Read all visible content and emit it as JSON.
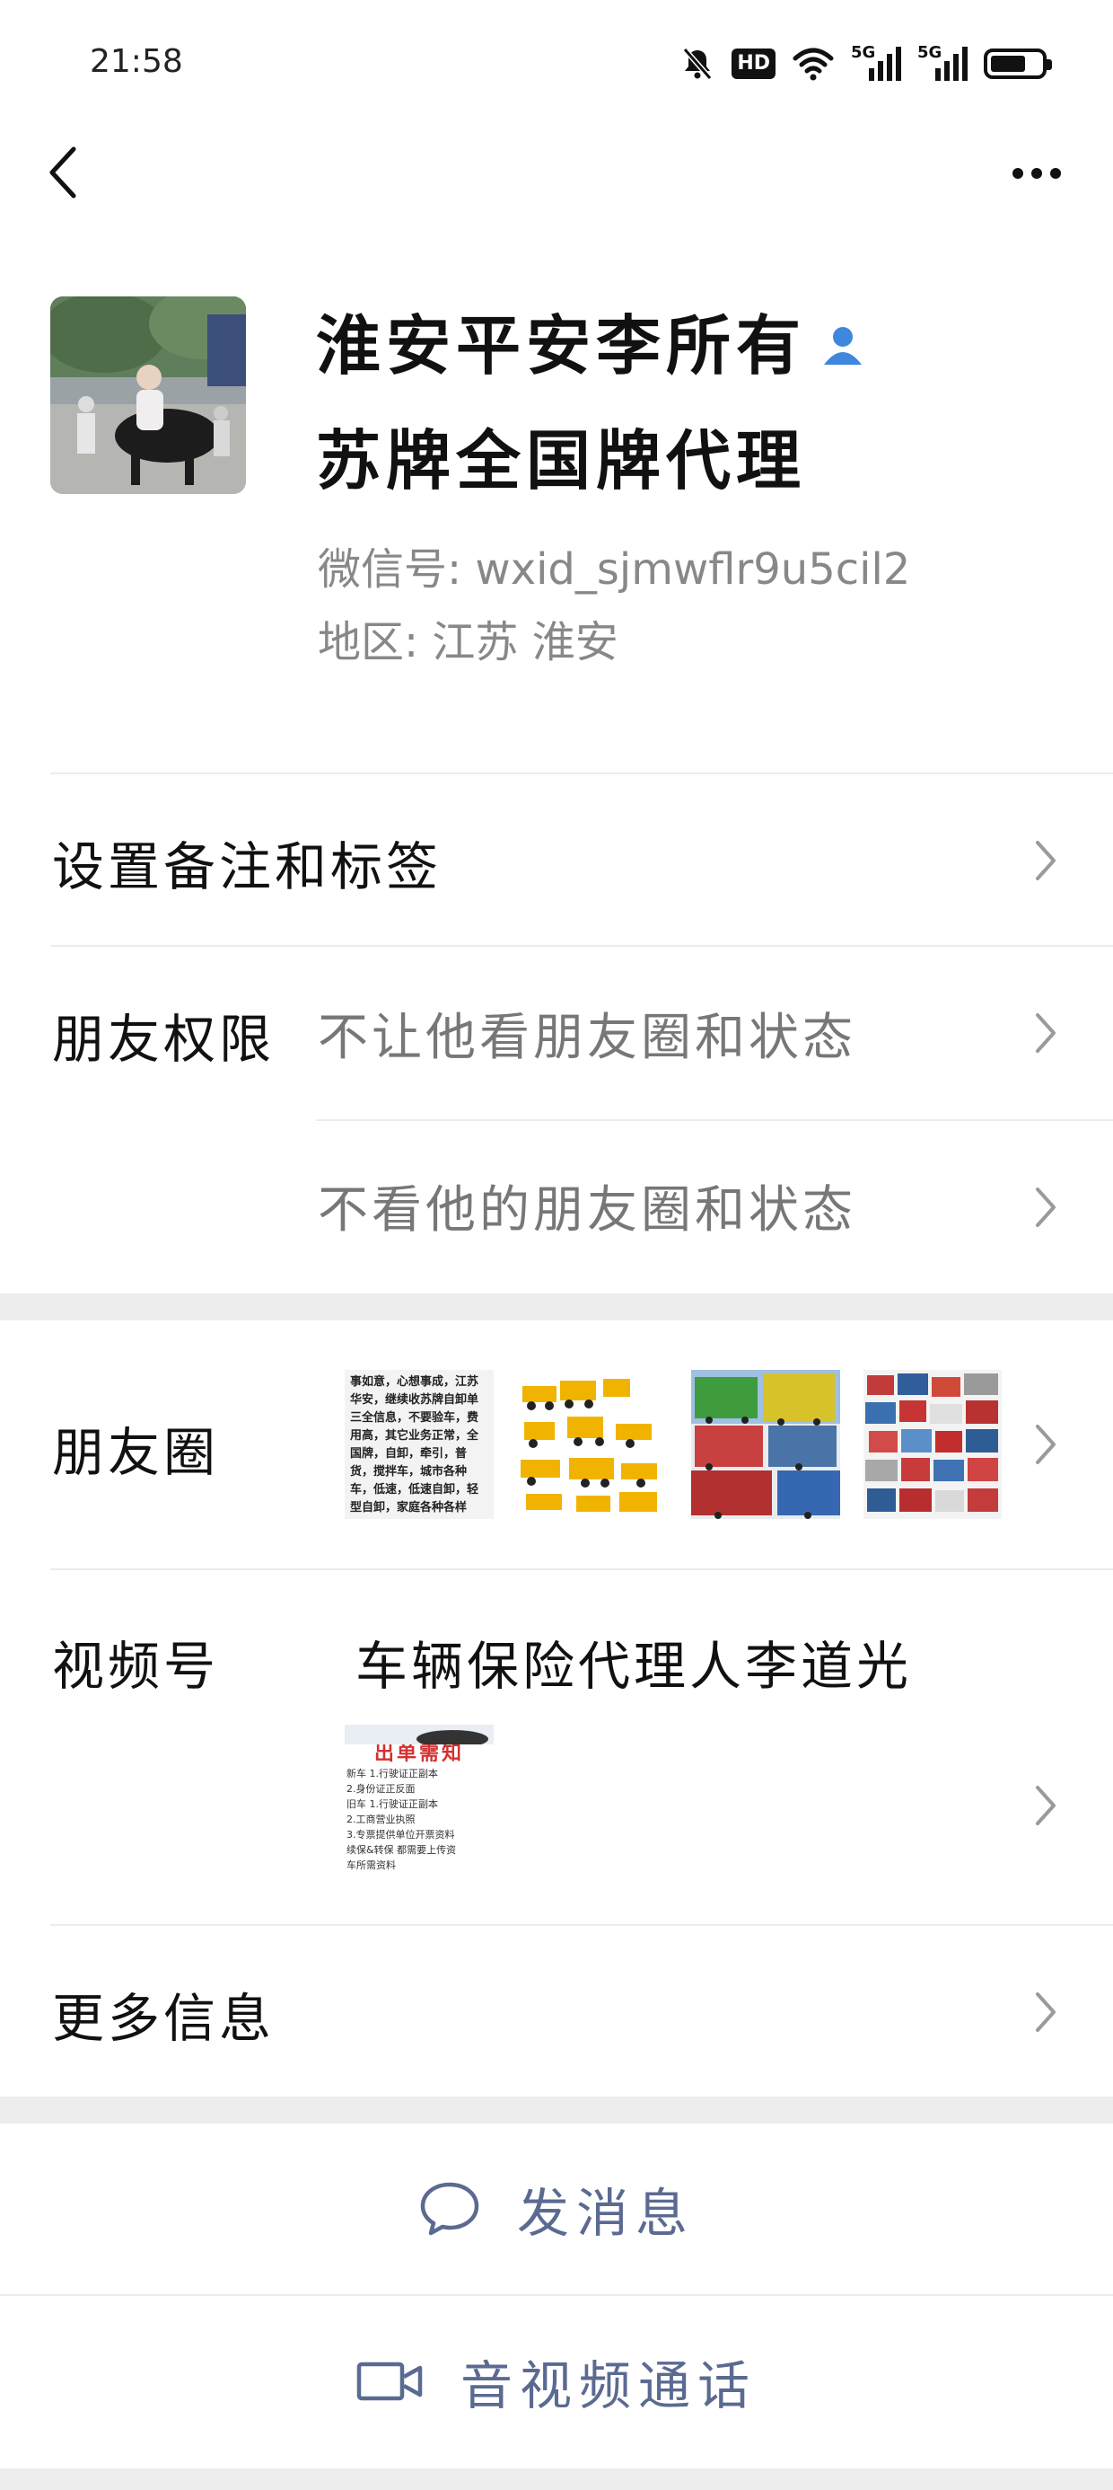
{
  "status_bar": {
    "time": "21:58",
    "hd_label": "HD",
    "signal_1": "5G",
    "signal_2": "5G",
    "battery_level": 0.7,
    "icons": [
      "bell-muted-icon",
      "hd-icon",
      "wifi-icon",
      "signal-5g-icon",
      "signal-5g-icon",
      "battery-icon"
    ]
  },
  "nav": {
    "back_icon": "chevron-left-icon",
    "more_icon": "more-dots-icon"
  },
  "profile": {
    "name_line_1": "淮安平安李所有",
    "name_line_2": "苏牌全国牌代理",
    "wechat_id": "微信号: wxid_sjmwflr9u5cil2",
    "region": "地区: 江苏 淮安"
  },
  "rows": {
    "remark": {
      "label": "设置备注和标签"
    },
    "permissions": {
      "label": "朋友权限",
      "value_1": "不让他看朋友圈和状态",
      "value_2": "不看他的朋友圈和状态"
    },
    "moments": {
      "label": "朋友圈",
      "thumb_1_text": "事如意，心想事成，江苏华安，继续收苏牌自卸单三全信息，不要验车，费用高，其它业务正常，全国牌，自卸，牵引，普货，搅拌车，城市各种车，低速，低速自卸，轻型自卸，家庭各种各样"
    },
    "channels": {
      "label": "视频号",
      "value": "车辆保险代理人李道光",
      "thumb_title": "出单需知",
      "thumb_lines": [
        "新车  1.行驶证正副本",
        "      2.身份证正反面",
        "旧车  1.行驶证正副本",
        "      2.工商营业执照",
        "      3.专票提供单位开票资料",
        "  续保&转保    都需要上传资",
        "车所需资料"
      ]
    },
    "more_info": {
      "label": "更多信息"
    }
  },
  "actions": {
    "message": "发消息",
    "call": "音视频通话"
  },
  "colors": {
    "accent_link": "#5b6a91",
    "verified_blue": "#3f86de",
    "divider": "#ececec",
    "section_gap": "#ededed"
  }
}
